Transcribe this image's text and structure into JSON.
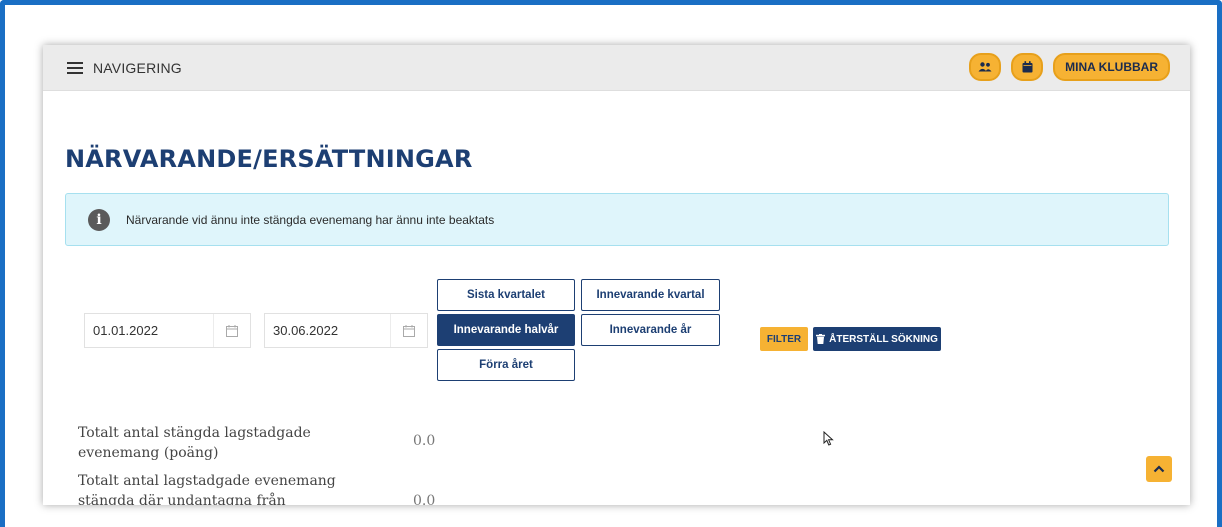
{
  "topbar": {
    "nav_label": "NAVIGERING",
    "clubs_button": "MINA KLUBBAR",
    "icons": [
      "menu-icon",
      "users-icon",
      "calendar-icon"
    ]
  },
  "page": {
    "title": "NÄRVARANDE/ERSÄTTNINGAR"
  },
  "alert": {
    "text": "Närvarande vid ännu inte stängda evenemang har ännu inte beaktats",
    "icon": "info-icon"
  },
  "filters": {
    "date_from": "01.01.2022",
    "date_to": "30.06.2022",
    "quick_ranges": {
      "last_quarter": "Sista kvartalet",
      "current_quarter": "Innevarande kvartal",
      "current_half": "Innevarande halvår",
      "current_year": "Innevarande år",
      "previous_year": "Förra året"
    },
    "active_range": "Innevarande halvår",
    "filter_label": "FILTER",
    "reset_label": "ÅTERSTÄLL SÖKNING"
  },
  "stats": [
    {
      "label": "Totalt antal stängda lagstadgade evenemang (poäng)",
      "value": "0.0"
    },
    {
      "label": "Totalt antal lagstadgade evenemang stängda där undantagna från närvaro",
      "value": "0.0"
    }
  ],
  "colors": {
    "accent_yellow": "#f6b233",
    "navy": "#1d3f73",
    "alert_bg": "#dff5fb",
    "frame_blue": "#1a6fc4"
  }
}
